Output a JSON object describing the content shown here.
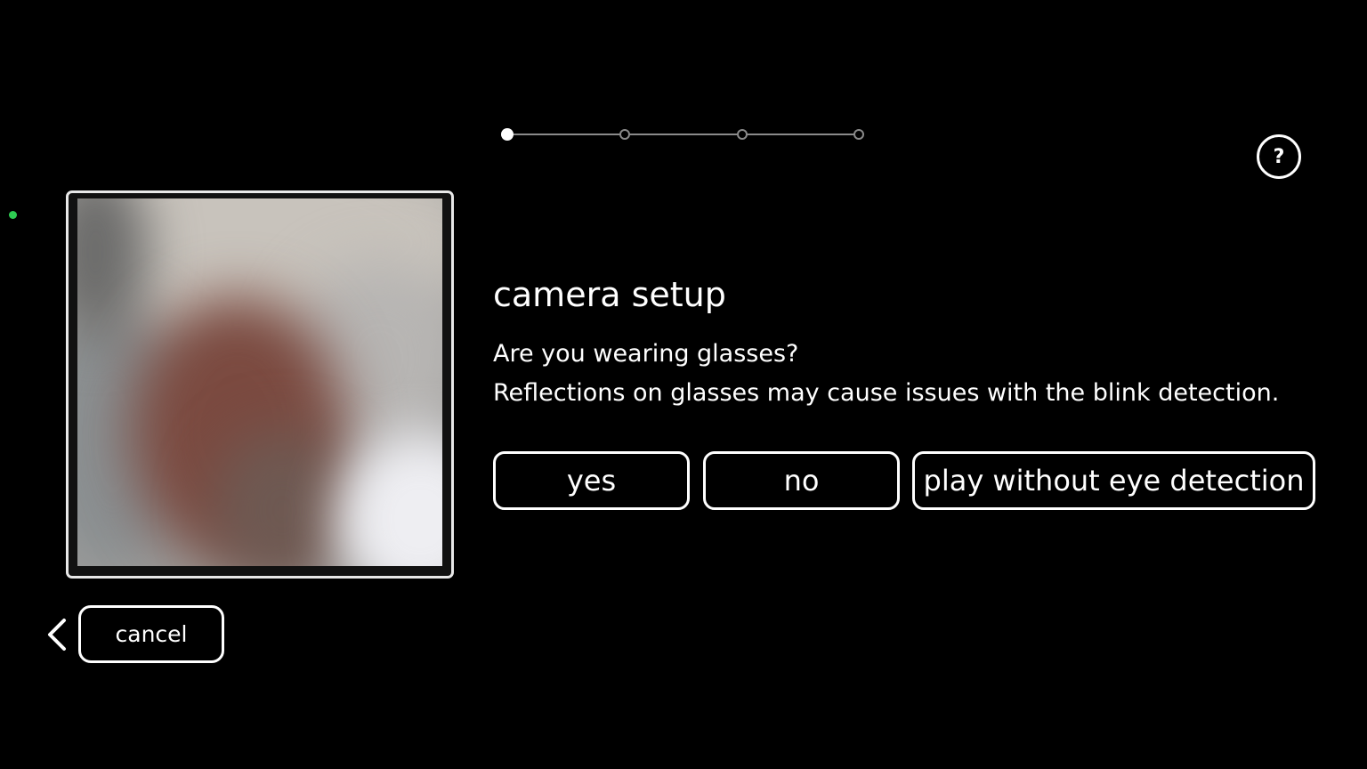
{
  "stepper": {
    "current_step": 1,
    "total_steps": 4
  },
  "help": {
    "label": "?"
  },
  "status": {
    "color": "#2ecc52"
  },
  "camera": {
    "icon": "camera-preview"
  },
  "content": {
    "title": "camera setup",
    "question": "Are you wearing glasses?",
    "note": "Reflections on glasses may cause issues with the blink detection."
  },
  "actions": {
    "yes_label": "yes",
    "no_label": "no",
    "play_without_label": "play without eye detection"
  },
  "footer": {
    "cancel_label": "cancel",
    "back_icon": "chevron-left-icon"
  }
}
